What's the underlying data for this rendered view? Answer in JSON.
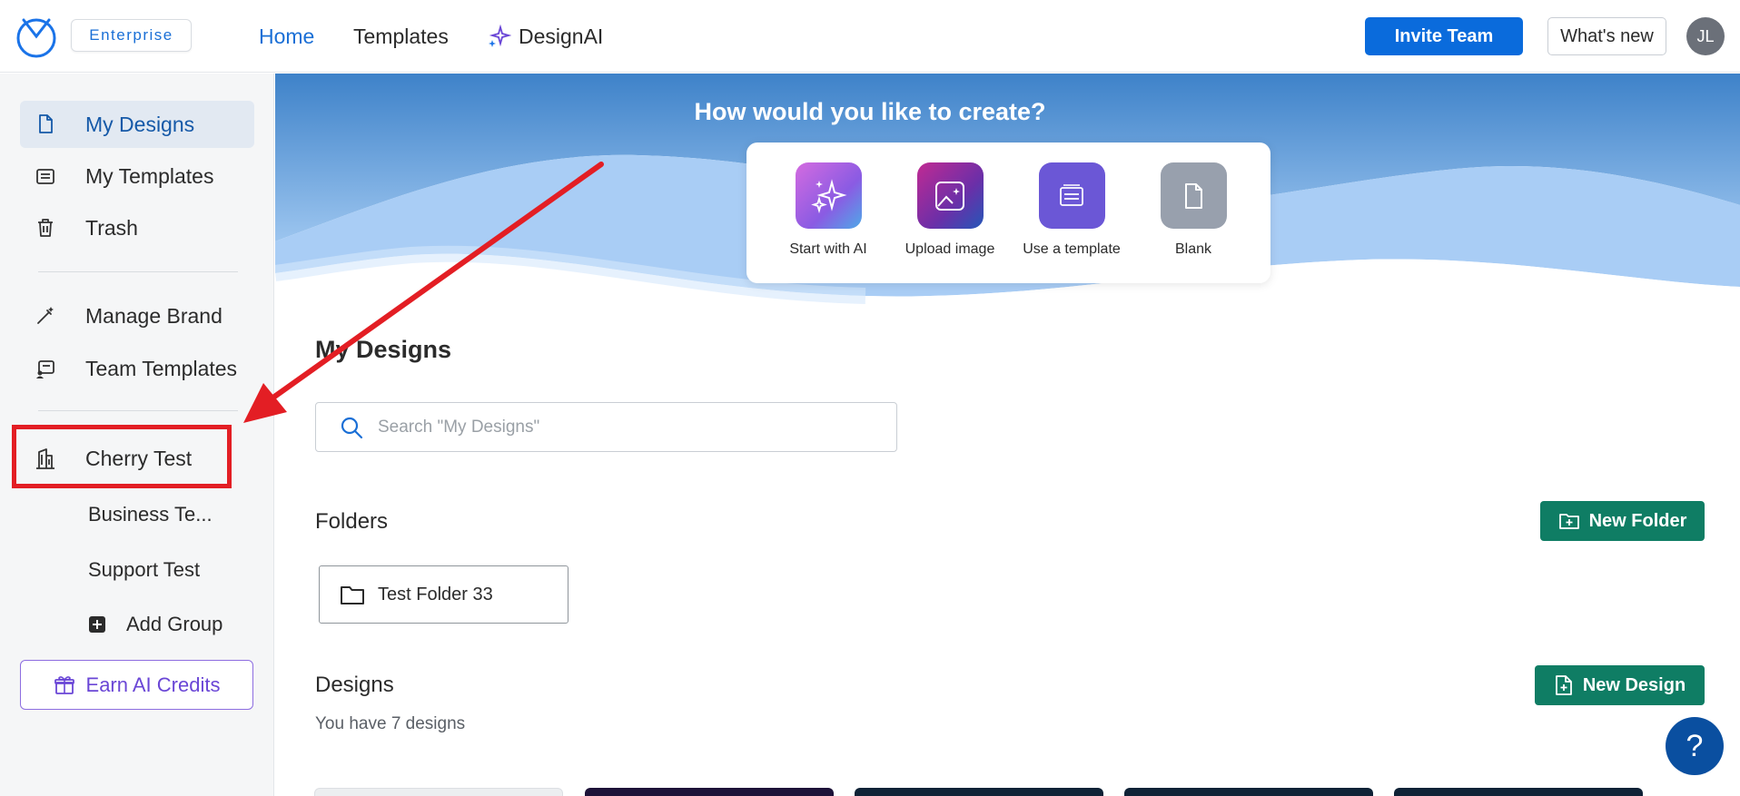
{
  "header": {
    "badge": "Enterprise",
    "nav": {
      "home": "Home",
      "templates": "Templates",
      "designai": "DesignAI"
    },
    "invite_label": "Invite Team",
    "whatsnew_label": "What's new",
    "avatar_initials": "JL"
  },
  "sidebar": {
    "items": [
      {
        "label": "My Designs",
        "icon": "document-icon",
        "active": true
      },
      {
        "label": "My Templates",
        "icon": "template-icon"
      },
      {
        "label": "Trash",
        "icon": "trash-icon"
      },
      {
        "label": "Manage Brand",
        "icon": "magic-wand-icon"
      },
      {
        "label": "Team Templates",
        "icon": "team-template-icon"
      },
      {
        "label": "Cherry Test",
        "icon": "building-icon"
      }
    ],
    "groups": [
      "Business Te...",
      "Support Test"
    ],
    "add_group": "Add Group",
    "earn_credits": "Earn AI Credits"
  },
  "hero": {
    "title": "How would you like to create?",
    "options": [
      {
        "label": "Start with AI",
        "icon": "sparkle-icon",
        "color": "#b06ee0"
      },
      {
        "label": "Upload image",
        "icon": "image-upload-icon",
        "color": "#a12f9e"
      },
      {
        "label": "Use a template",
        "icon": "template-icon",
        "color": "#6b57d6"
      },
      {
        "label": "Blank",
        "icon": "blank-page-icon",
        "color": "#98a0ad"
      }
    ]
  },
  "main": {
    "title": "My Designs",
    "search_placeholder": "Search \"My Designs\"",
    "folders_title": "Folders",
    "new_folder": "New Folder",
    "folders": [
      {
        "name": "Test Folder 33"
      }
    ],
    "designs_title": "Designs",
    "new_design": "New Design",
    "designs_count": "You have 7 designs",
    "help": "?"
  },
  "colors": {
    "primary": "#0a6bdc",
    "green": "#0f7d64",
    "annotation": "#e31e24",
    "ai_purple": "#6a46d6"
  }
}
